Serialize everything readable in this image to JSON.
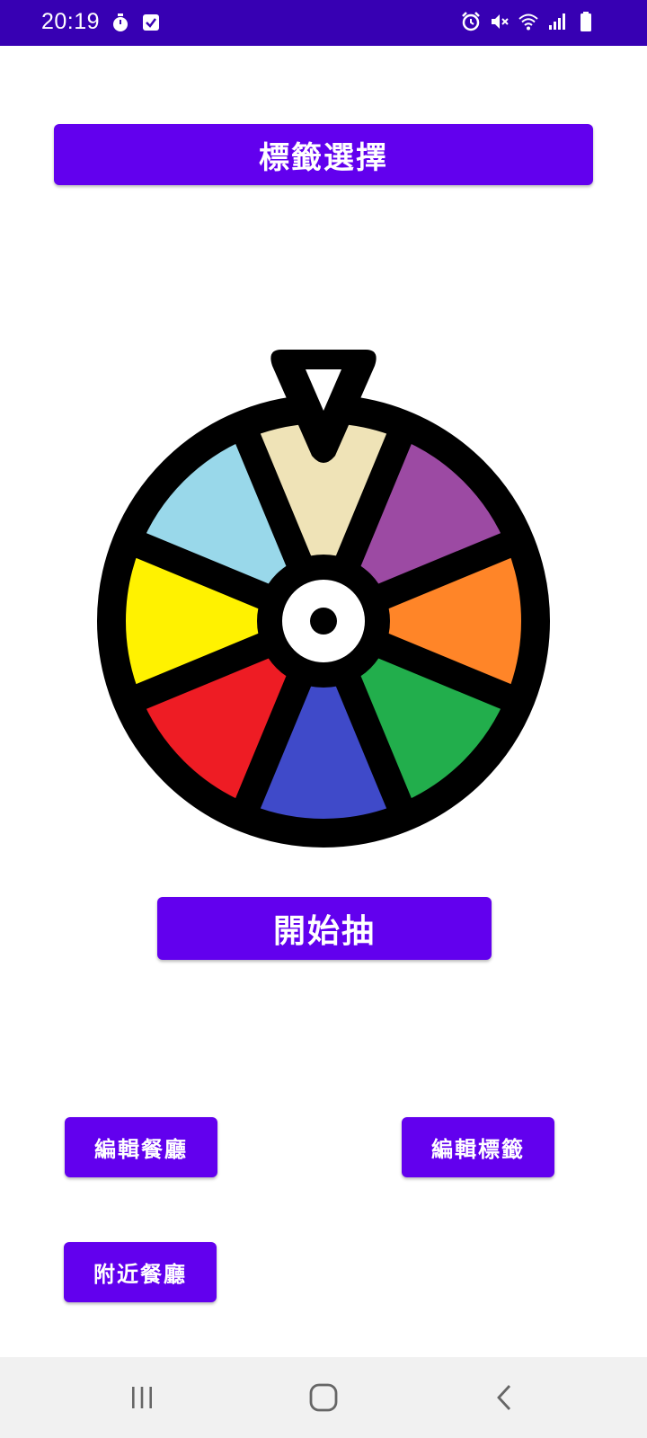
{
  "status_bar": {
    "time": "20:19",
    "left_icons": [
      "timer-icon",
      "checkbox-icon"
    ],
    "right_icons": [
      "alarm-icon",
      "mute-icon",
      "wifi-icon",
      "signal-icon",
      "battery-icon"
    ],
    "background": "#3700b3"
  },
  "tag_select_button": {
    "label": "標籤選擇"
  },
  "wheel": {
    "description_icon": "spin-wheel-icon",
    "segment_colors": [
      "#efe3b7",
      "#9c4aa3",
      "#ff8528",
      "#22ae4c",
      "#3f4ac9",
      "#ee1c24",
      "#fff200",
      "#99d8ea"
    ]
  },
  "start_button": {
    "label": "開始抽"
  },
  "edit_restaurant_button": {
    "label": "編輯餐廳"
  },
  "edit_tag_button": {
    "label": "編輯標籤"
  },
  "nearby_restaurant_button": {
    "label": "附近餐廳"
  },
  "nav_bar": {
    "icons": [
      "recent-apps-icon",
      "home-icon",
      "back-icon"
    ]
  },
  "colors": {
    "primary": "#6200ee",
    "primary_dark": "#3700b3",
    "button_text": "#ffffff"
  }
}
